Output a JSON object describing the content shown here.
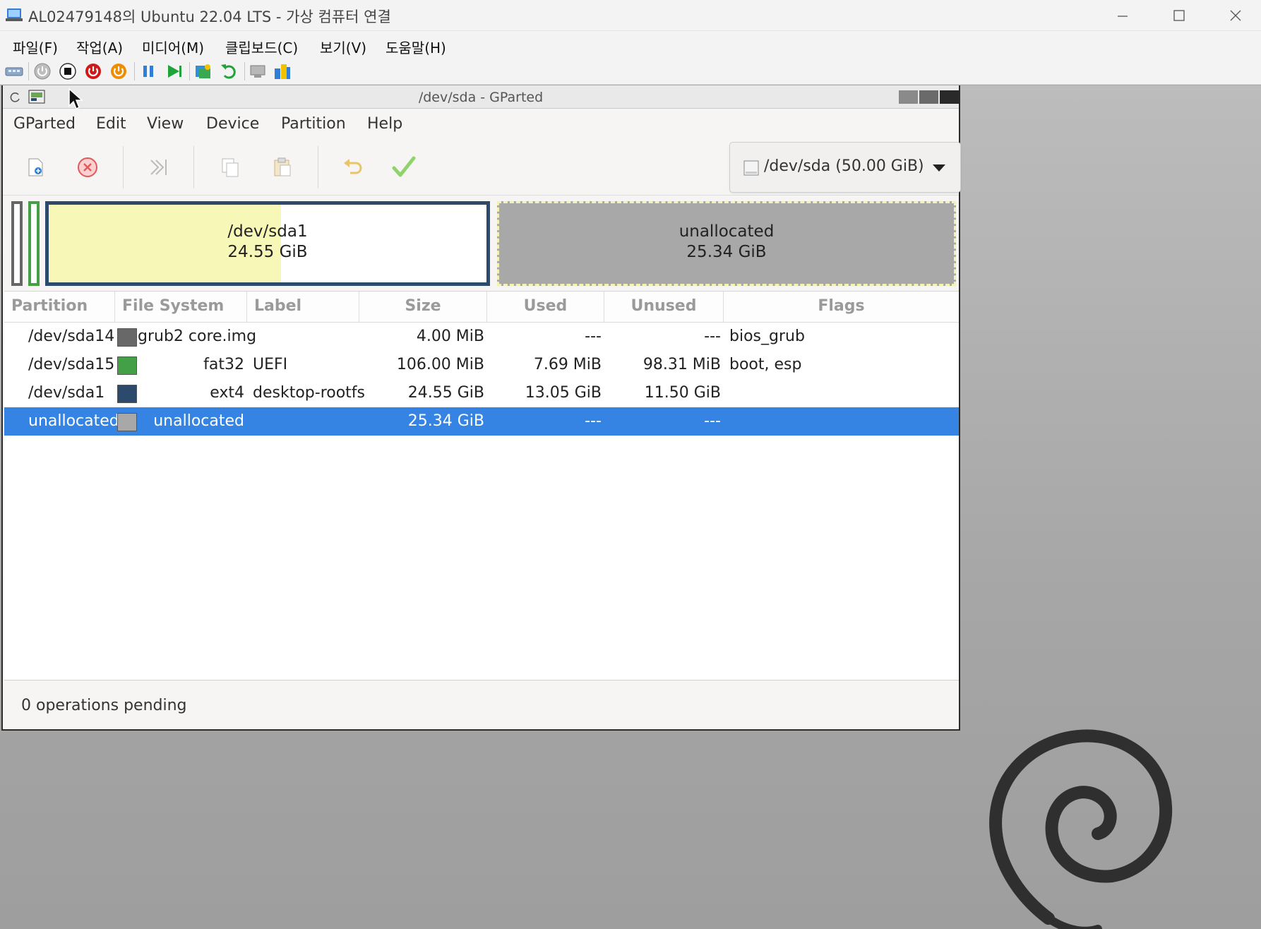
{
  "host": {
    "title": "AL02479148의 Ubuntu 22.04 LTS - 가상 컴퓨터 연결",
    "menu": [
      "파일(F)",
      "작업(A)",
      "미디어(M)",
      "클립보드(C)",
      "보기(V)",
      "도움말(H)"
    ],
    "toolbar_icons": [
      "ctrl-alt-del-icon",
      "start-icon",
      "turn-off-icon",
      "shut-down-icon",
      "power-icon",
      "pause-icon",
      "resume-icon",
      "checkpoint-icon",
      "revert-icon",
      "enhanced-session-icon",
      "share-icon"
    ]
  },
  "gparted": {
    "title": "/dev/sda - GParted",
    "menu": [
      "GParted",
      "Edit",
      "View",
      "Device",
      "Partition",
      "Help"
    ],
    "device": "/dev/sda (50.00 GiB)",
    "map": {
      "sda1": {
        "name": "/dev/sda1",
        "size": "24.55 GiB",
        "used_fraction": 0.53
      },
      "unallocated": {
        "name": "unallocated",
        "size": "25.34 GiB"
      }
    },
    "columns": [
      "Partition",
      "File System",
      "Label",
      "Size",
      "Used",
      "Unused",
      "Flags"
    ],
    "rows": [
      {
        "partition": "/dev/sda14",
        "fs": "grub2 core.img",
        "label": "",
        "size": "4.00 MiB",
        "used": "---",
        "unused": "---",
        "flags": "bios_grub",
        "color": "#686868"
      },
      {
        "partition": "/dev/sda15",
        "fs": "fat32",
        "label": "UEFI",
        "size": "106.00 MiB",
        "used": "7.69 MiB",
        "unused": "98.31 MiB",
        "flags": "boot, esp",
        "color": "#43a047"
      },
      {
        "partition": "/dev/sda1",
        "fs": "ext4",
        "label": "desktop-rootfs",
        "size": "24.55 GiB",
        "used": "13.05 GiB",
        "unused": "11.50 GiB",
        "flags": "",
        "color": "#2c4a6b"
      },
      {
        "partition": "unallocated",
        "fs": "unallocated",
        "label": "",
        "size": "25.34 GiB",
        "used": "---",
        "unused": "---",
        "flags": "",
        "color": "#a8a8a8"
      }
    ],
    "status": "0 operations pending"
  },
  "colors": {
    "selection": "#3584e4",
    "sda1_border": "#2c4a6b",
    "sda1_used": "#f7f7b7",
    "unallocated": "#a8a8a8",
    "fat32": "#43a047"
  }
}
